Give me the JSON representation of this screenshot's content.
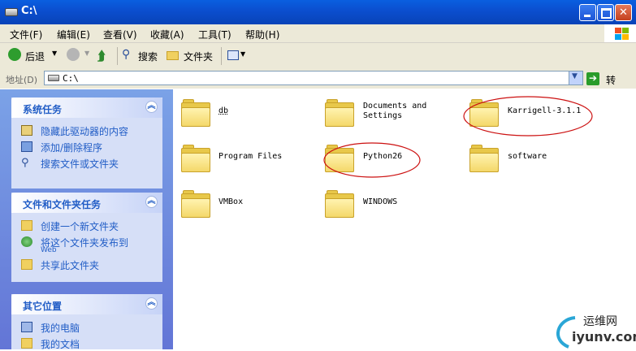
{
  "window": {
    "title": "C:\\"
  },
  "menu": [
    "文件(F)",
    "编辑(E)",
    "查看(V)",
    "收藏(A)",
    "工具(T)",
    "帮助(H)"
  ],
  "toolbar": {
    "back": "后退",
    "search": "搜索",
    "folders": "文件夹"
  },
  "address": {
    "label": "地址(D)",
    "value": "C:\\",
    "go": "转到"
  },
  "panels": [
    {
      "title": "系统任务",
      "items": [
        "隐藏此驱动器的内容",
        "添加/删除程序",
        "搜索文件或文件夹"
      ]
    },
    {
      "title": "文件和文件夹任务",
      "items": [
        "创建一个新文件夹",
        "将这个文件夹发布到",
        "Web",
        "共享此文件夹"
      ]
    },
    {
      "title": "其它位置",
      "items": [
        "我的电脑",
        "我的文档"
      ]
    }
  ],
  "folders": [
    {
      "name": "db"
    },
    {
      "name": "Documents and",
      "name2": "Settings"
    },
    {
      "name": "Karrigell-3.1.1",
      "circled": true
    },
    {
      "name": "Program Files"
    },
    {
      "name": "Python26",
      "circled": true
    },
    {
      "name": "software"
    },
    {
      "name": "VMBox"
    },
    {
      "name": "WINDOWS"
    }
  ],
  "watermark": {
    "line1": "运维网",
    "line2": "iyunv.com"
  }
}
